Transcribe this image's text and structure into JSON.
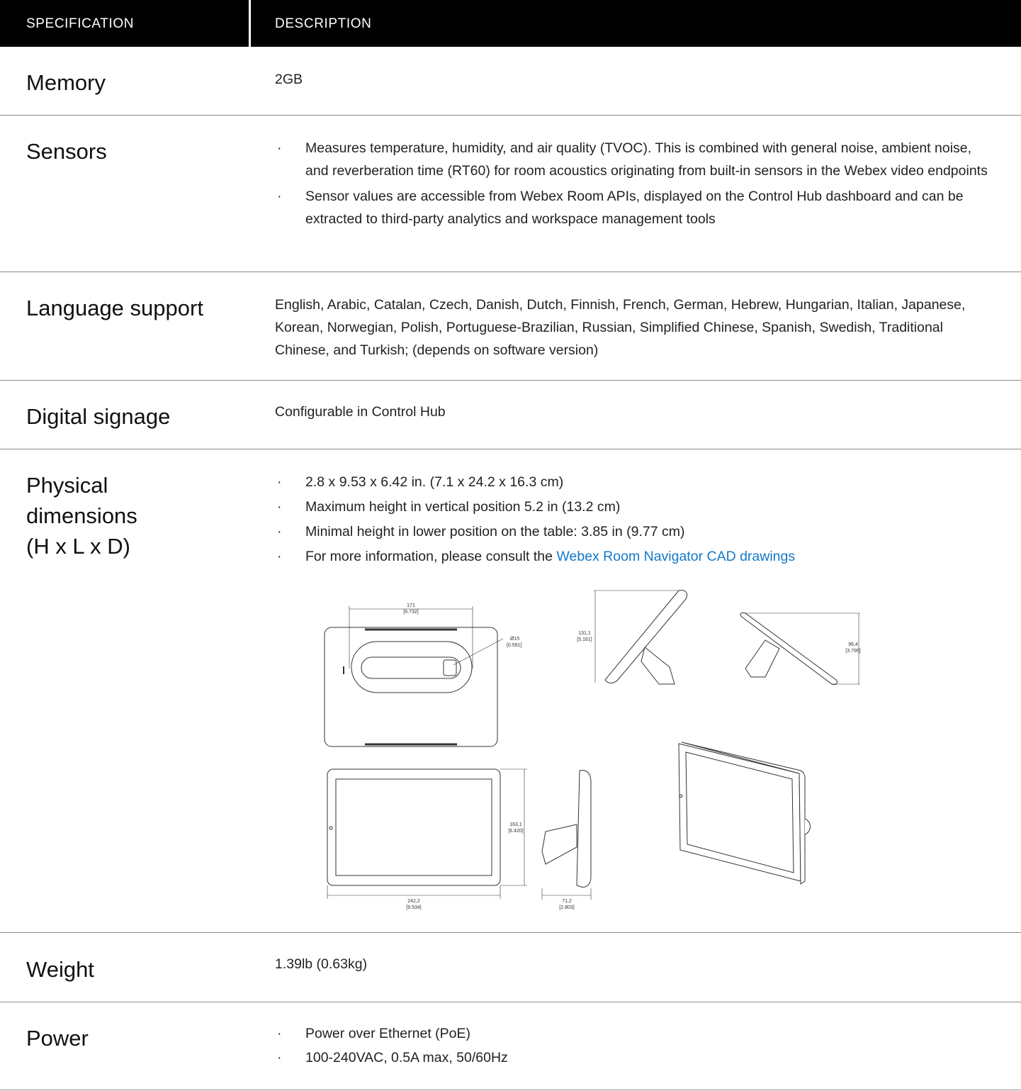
{
  "header": {
    "spec_label": "SPECIFICATION",
    "desc_label": "DESCRIPTION"
  },
  "rows": {
    "memory": {
      "label": "Memory",
      "value": "2GB"
    },
    "sensors": {
      "label": "Sensors",
      "items": [
        "Measures temperature, humidity, and air quality (TVOC). This is combined with general noise, ambient noise, and reverberation time (RT60) for room acoustics originating from built-in sensors in the Webex video endpoints",
        "Sensor values are accessible from Webex Room APIs, displayed on the Control Hub dashboard and can be extracted to third-party analytics and workspace management tools"
      ]
    },
    "language": {
      "label": "Language support",
      "value": "English, Arabic, Catalan, Czech, Danish, Dutch, Finnish, French, German, Hebrew, Hungarian, Italian, Japanese, Korean, Norwegian, Polish, Portuguese-Brazilian, Russian, Simplified Chinese, Spanish, Swedish, Traditional Chinese, and Turkish; (depends on software version)"
    },
    "signage": {
      "label": "Digital signage",
      "value": "Configurable in Control Hub"
    },
    "dimensions": {
      "label_line1": "Physical",
      "label_line2": "dimensions",
      "label_line3": "(H x L x D)",
      "items": [
        "2.8 x 9.53 x 6.42 in. (7.1 x 24.2 x 16.3 cm)",
        "Maximum height in vertical position 5.2 in (13.2 cm)",
        "Minimal height in lower position on the table: 3.85 in (9.77 cm)"
      ],
      "link_prefix": "For more information, please consult the ",
      "link_text": "Webex Room Navigator CAD drawings",
      "drawing_labels": {
        "d171": "171",
        "d171_in": "[6.732]",
        "d15": "Ø15",
        "d15_in": "[0.591]",
        "d131": "131,1",
        "d131_in": "[5.161]",
        "d96": "96,4",
        "d96_in": "[3.795]",
        "d163": "163,1",
        "d163_in": "[6.420]",
        "d242": "242,2",
        "d242_in": "[9.534]",
        "d71": "71,2",
        "d71_in": "[2.803]"
      }
    },
    "weight": {
      "label": "Weight",
      "value": "1.39lb (0.63kg)"
    },
    "power": {
      "label": "Power",
      "items": [
        "Power over Ethernet (PoE)",
        "100-240VAC, 0.5A max, 50/60Hz"
      ]
    }
  },
  "bullet": "·",
  "colors": {
    "header_bg": "#000000",
    "link": "#1478c8",
    "divider": "#8a8a8a"
  }
}
